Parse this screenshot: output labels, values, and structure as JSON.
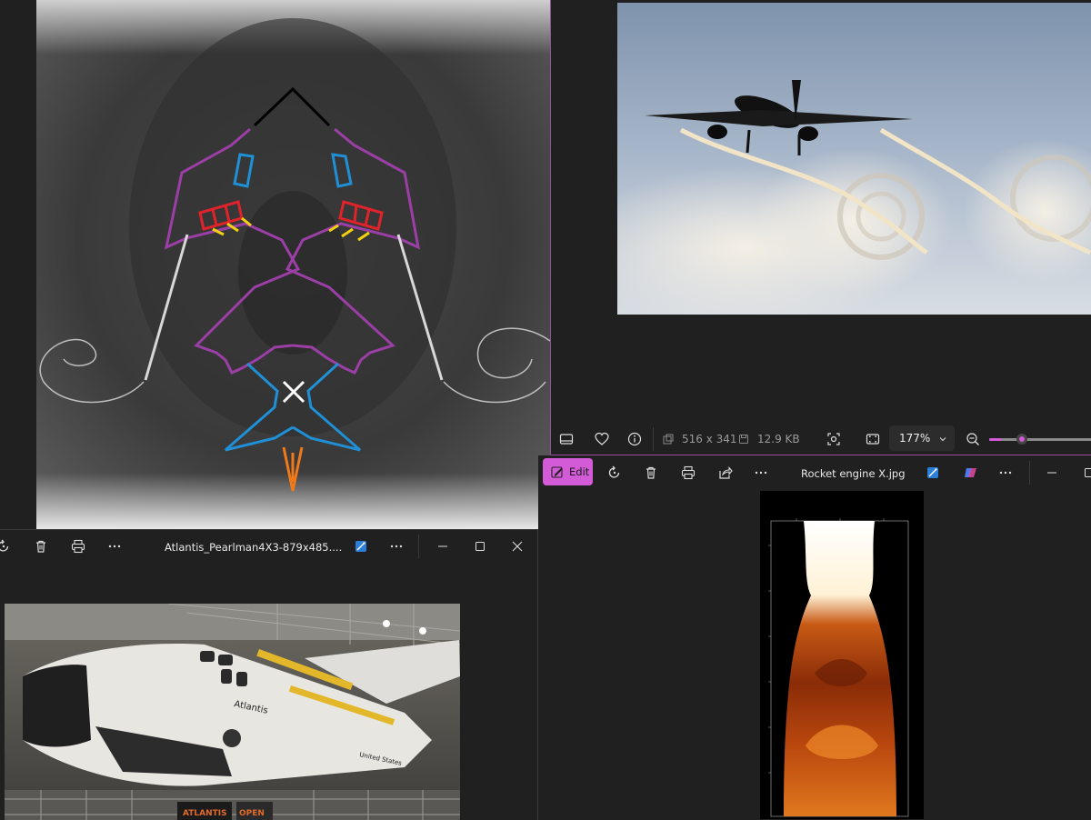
{
  "window_bottom_left": {
    "title": "Atlantis_Pearlman4X3-879x485....",
    "photo_text": {
      "ship_name": "Atlantis",
      "flag_text": "United States",
      "banner_left": "ATLANTIS",
      "banner_right": "OPEN"
    }
  },
  "window_top_right": {
    "status": {
      "dimensions": "516 x 341",
      "file_size": "12.9 KB",
      "zoom": "177%"
    },
    "zoom_slider_fraction": 0.12
  },
  "window_bottom_right": {
    "edit_label": "Edit",
    "title": "Rocket engine X.jpg"
  },
  "colors": {
    "accent": "#d45bd8",
    "window_bg": "#202020",
    "border": "#a04aa8"
  },
  "icons": [
    "rotate-icon",
    "delete-icon",
    "print-icon",
    "more-icon",
    "share-icon",
    "heart-icon",
    "info-icon",
    "filmstrip-icon",
    "fit-icon",
    "fullscreen-icon",
    "zoom-out-icon",
    "ai-icon",
    "copilot-icon",
    "minimize-icon",
    "maximize-icon",
    "close-icon",
    "edit-icon",
    "chevron-down-icon"
  ]
}
